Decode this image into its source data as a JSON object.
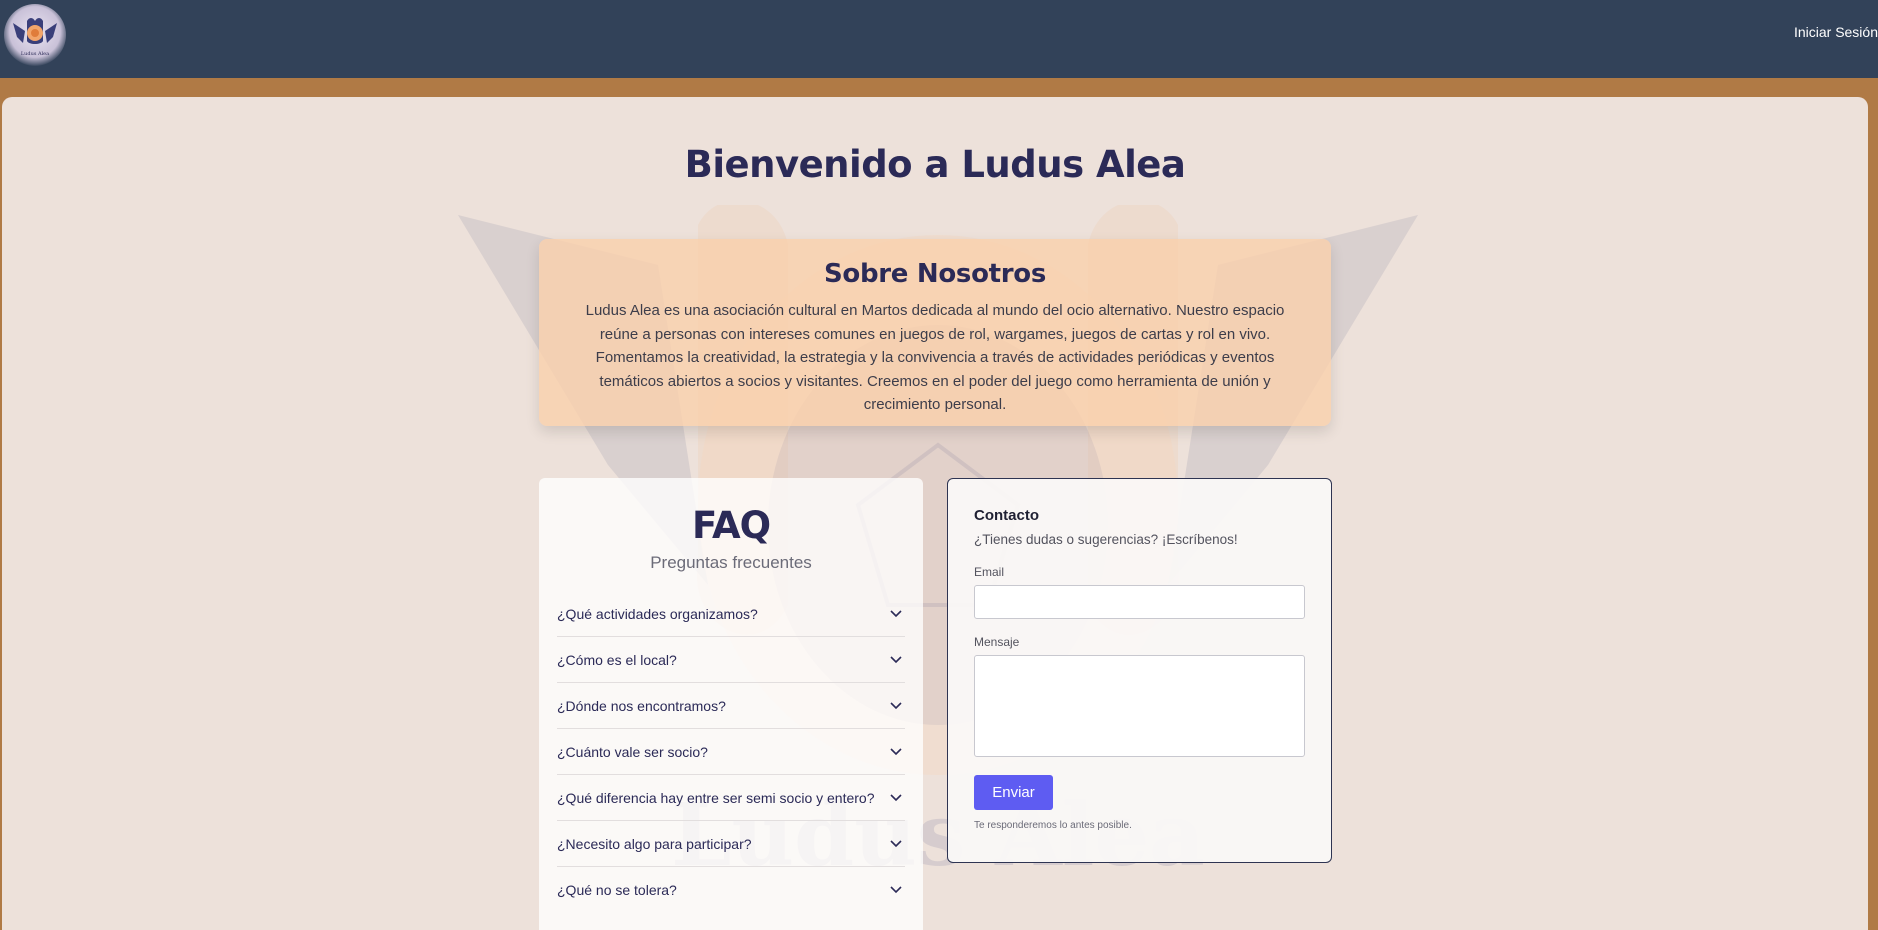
{
  "header": {
    "logo_icon": "ludus-alea-logo-icon",
    "logo_text": "Ludus Alea",
    "login_link": "Iniciar Sesión"
  },
  "main": {
    "title": "Bienvenido a Ludus Alea",
    "watermark_text": "Ludus Alea"
  },
  "about": {
    "heading": "Sobre Nosotros",
    "body": "Ludus Alea es una asociación cultural en Martos dedicada al mundo del ocio alternativo. Nuestro espacio reúne a personas con intereses comunes en juegos de rol, wargames, juegos de cartas y rol en vivo. Fomentamos la creatividad, la estrategia y la convivencia a través de actividades periódicas y eventos temáticos abiertos a socios y visitantes. Creemos en el poder del juego como herramienta de unión y crecimiento personal."
  },
  "faq": {
    "heading": "FAQ",
    "subtitle": "Preguntas frecuentes",
    "items": [
      {
        "question": "¿Qué actividades organizamos?",
        "icon": "chevron-down-icon"
      },
      {
        "question": "¿Cómo es el local?",
        "icon": "chevron-down-icon"
      },
      {
        "question": "¿Dónde nos encontramos?",
        "icon": "chevron-down-icon"
      },
      {
        "question": "¿Cuánto vale ser socio?",
        "icon": "chevron-down-icon"
      },
      {
        "question": "¿Qué diferencia hay entre ser semi socio y entero?",
        "icon": "chevron-down-icon"
      },
      {
        "question": "¿Necesito algo para participar?",
        "icon": "chevron-down-icon"
      },
      {
        "question": "¿Qué no se tolera?",
        "icon": "chevron-down-icon"
      }
    ]
  },
  "contact": {
    "heading": "Contacto",
    "lead": "¿Tienes dudas o sugerencias? ¡Escríbenos!",
    "email_label": "Email",
    "email_value": "",
    "message_label": "Mensaje",
    "message_value": "",
    "submit_label": "Enviar",
    "note": "Te responderemos lo antes posible."
  },
  "colors": {
    "topbar": "#324259",
    "accent_band": "#b07a45",
    "page_bg": "#ede1da",
    "heading": "#2b2a57",
    "about_card": "#facfaa",
    "submit_button": "#5e5cf2"
  }
}
